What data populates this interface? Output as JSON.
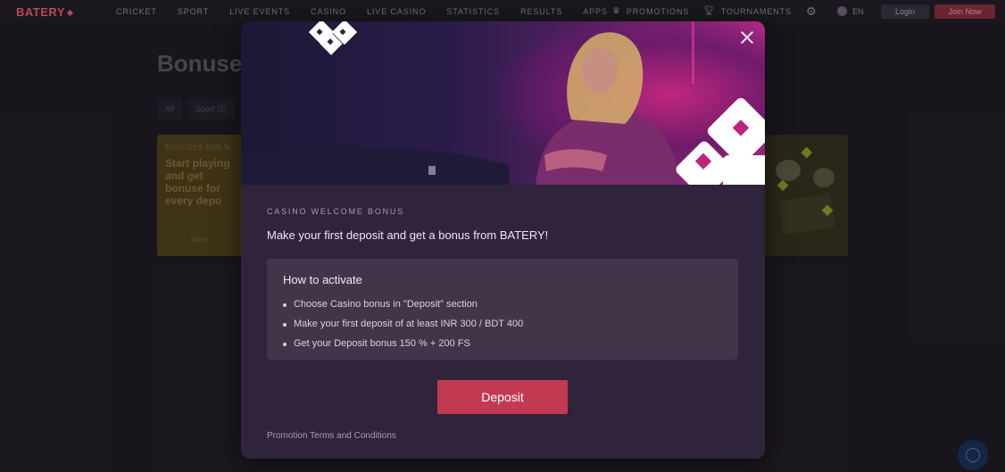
{
  "header": {
    "logo": "BATERY",
    "nav": [
      "CRICKET",
      "SPORT",
      "LIVE EVENTS",
      "CASINO",
      "LIVE CASINO",
      "STATISTICS",
      "RESULTS",
      "APPS"
    ],
    "promotions": "PROMOTIONS",
    "tournaments": "TOURNAMENTS",
    "language": "EN",
    "login": "Login",
    "join": "Join Now"
  },
  "page": {
    "title": "Bonuse",
    "filters": [
      "All",
      "Sport (2)"
    ],
    "card": {
      "tag": "BONUSES FOR N",
      "text": "Start playing and get bonuse for every depo",
      "more": "More"
    }
  },
  "modal": {
    "subtitle": "CASINO WELCOME BONUS",
    "headline": "Make your first deposit and get a bonus from BATERY!",
    "activate_title": "How to activate",
    "steps": [
      "Choose Casino bonus in \"Deposit\" section",
      "Make your first deposit of at least INR 300 / BDT 400",
      "Get your Deposit bonus 150 % + 200 FS"
    ],
    "deposit_label": "Deposit",
    "terms": "Promotion Terms and Conditions"
  },
  "colors": {
    "accent": "#c23a52",
    "modal_bg": "#30243b",
    "page_bg": "#221e27"
  },
  "icons": [
    "trophy-icon",
    "gear-icon",
    "globe-icon",
    "close-icon",
    "chat-icon"
  ]
}
